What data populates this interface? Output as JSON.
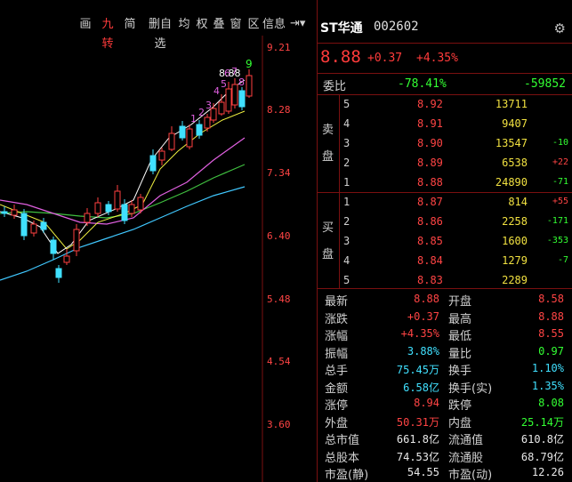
{
  "toolbar": {
    "items": [
      {
        "label": "画",
        "name": "draw"
      },
      {
        "label": "九转",
        "name": "nine-turn",
        "active": true
      },
      {
        "label": "简",
        "name": "simple"
      },
      {
        "label": "删自选",
        "name": "remove-watchlist"
      },
      {
        "label": "均",
        "name": "average"
      },
      {
        "label": "权",
        "name": "rights"
      },
      {
        "label": "叠",
        "name": "overlay"
      },
      {
        "label": "窗",
        "name": "window"
      },
      {
        "label": "区",
        "name": "range"
      },
      {
        "label": "信息",
        "name": "info"
      }
    ]
  },
  "price_axis": [
    "9.21",
    "8.28",
    "7.34",
    "6.40",
    "5.48",
    "4.54",
    "3.60"
  ],
  "nine_turn_labels": {
    "count": "8.88",
    "digits": [
      "1",
      "2",
      "3",
      "4",
      "5",
      "6",
      "7",
      "8",
      "9"
    ]
  },
  "stock": {
    "name": "ST华通",
    "code": "002602",
    "price": "8.88",
    "change": "+0.37",
    "change_pct": "+4.35%"
  },
  "weibi": {
    "label": "委比",
    "pct": "-78.41%",
    "diff": "-59852"
  },
  "sell_side": {
    "label_top": "卖",
    "label_bottom": "盘",
    "levels": [
      {
        "lvl": "5",
        "price": "8.92",
        "vol": "13711",
        "delta": ""
      },
      {
        "lvl": "4",
        "price": "8.91",
        "vol": "9407",
        "delta": ""
      },
      {
        "lvl": "3",
        "price": "8.90",
        "vol": "13547",
        "delta": "-10",
        "dir": "dn"
      },
      {
        "lvl": "2",
        "price": "8.89",
        "vol": "6538",
        "delta": "+22",
        "dir": "up"
      },
      {
        "lvl": "1",
        "price": "8.88",
        "vol": "24890",
        "delta": "-71",
        "dir": "dn"
      }
    ]
  },
  "buy_side": {
    "label_top": "买",
    "label_bottom": "盘",
    "levels": [
      {
        "lvl": "1",
        "price": "8.87",
        "vol": "814",
        "delta": "+55",
        "dir": "up"
      },
      {
        "lvl": "2",
        "price": "8.86",
        "vol": "2258",
        "delta": "-171",
        "dir": "dn"
      },
      {
        "lvl": "3",
        "price": "8.85",
        "vol": "1600",
        "delta": "-353",
        "dir": "dn"
      },
      {
        "lvl": "4",
        "price": "8.84",
        "vol": "1279",
        "delta": "-7",
        "dir": "dn"
      },
      {
        "lvl": "5",
        "price": "8.83",
        "vol": "2289",
        "delta": ""
      }
    ]
  },
  "stats": [
    {
      "l1": "最新",
      "v1": "8.88",
      "c1": "red",
      "l2": "开盘",
      "v2": "8.58",
      "c2": "red"
    },
    {
      "l1": "涨跌",
      "v1": "+0.37",
      "c1": "red",
      "l2": "最高",
      "v2": "8.88",
      "c2": "red"
    },
    {
      "l1": "涨幅",
      "v1": "+4.35%",
      "c1": "red",
      "l2": "最低",
      "v2": "8.55",
      "c2": "red"
    },
    {
      "l1": "振幅",
      "v1": "3.88%",
      "c1": "cyan",
      "l2": "量比",
      "v2": "0.97",
      "c2": "green"
    },
    {
      "l1": "总手",
      "v1": "75.45万",
      "c1": "cyan",
      "l2": "换手",
      "v2": "1.10%",
      "c2": "cyan"
    },
    {
      "l1": "金额",
      "v1": "6.58亿",
      "c1": "cyan",
      "l2": "换手(实)",
      "v2": "1.35%",
      "c2": "cyan"
    },
    {
      "l1": "涨停",
      "v1": "8.94",
      "c1": "red",
      "l2": "跌停",
      "v2": "8.08",
      "c2": "green"
    },
    {
      "l1": "外盘",
      "v1": "50.31万",
      "c1": "red",
      "l2": "内盘",
      "v2": "25.14万",
      "c2": "green"
    },
    {
      "l1": "总市值",
      "v1": "661.8亿",
      "c1": "white",
      "l2": "流通值",
      "v2": "610.8亿",
      "c2": "white"
    },
    {
      "l1": "总股本",
      "v1": "74.53亿",
      "c1": "white",
      "l2": "流通股",
      "v2": "68.79亿",
      "c2": "white"
    },
    {
      "l1": "市盈(静)",
      "v1": "54.55",
      "c1": "white",
      "l2": "市盈(动)",
      "v2": "12.26",
      "c2": "white"
    }
  ],
  "colors": {
    "up": "#ff4444",
    "down": "#33ff33",
    "volume": "#f0e040",
    "border": "#7a1010",
    "bg": "#000000"
  }
}
